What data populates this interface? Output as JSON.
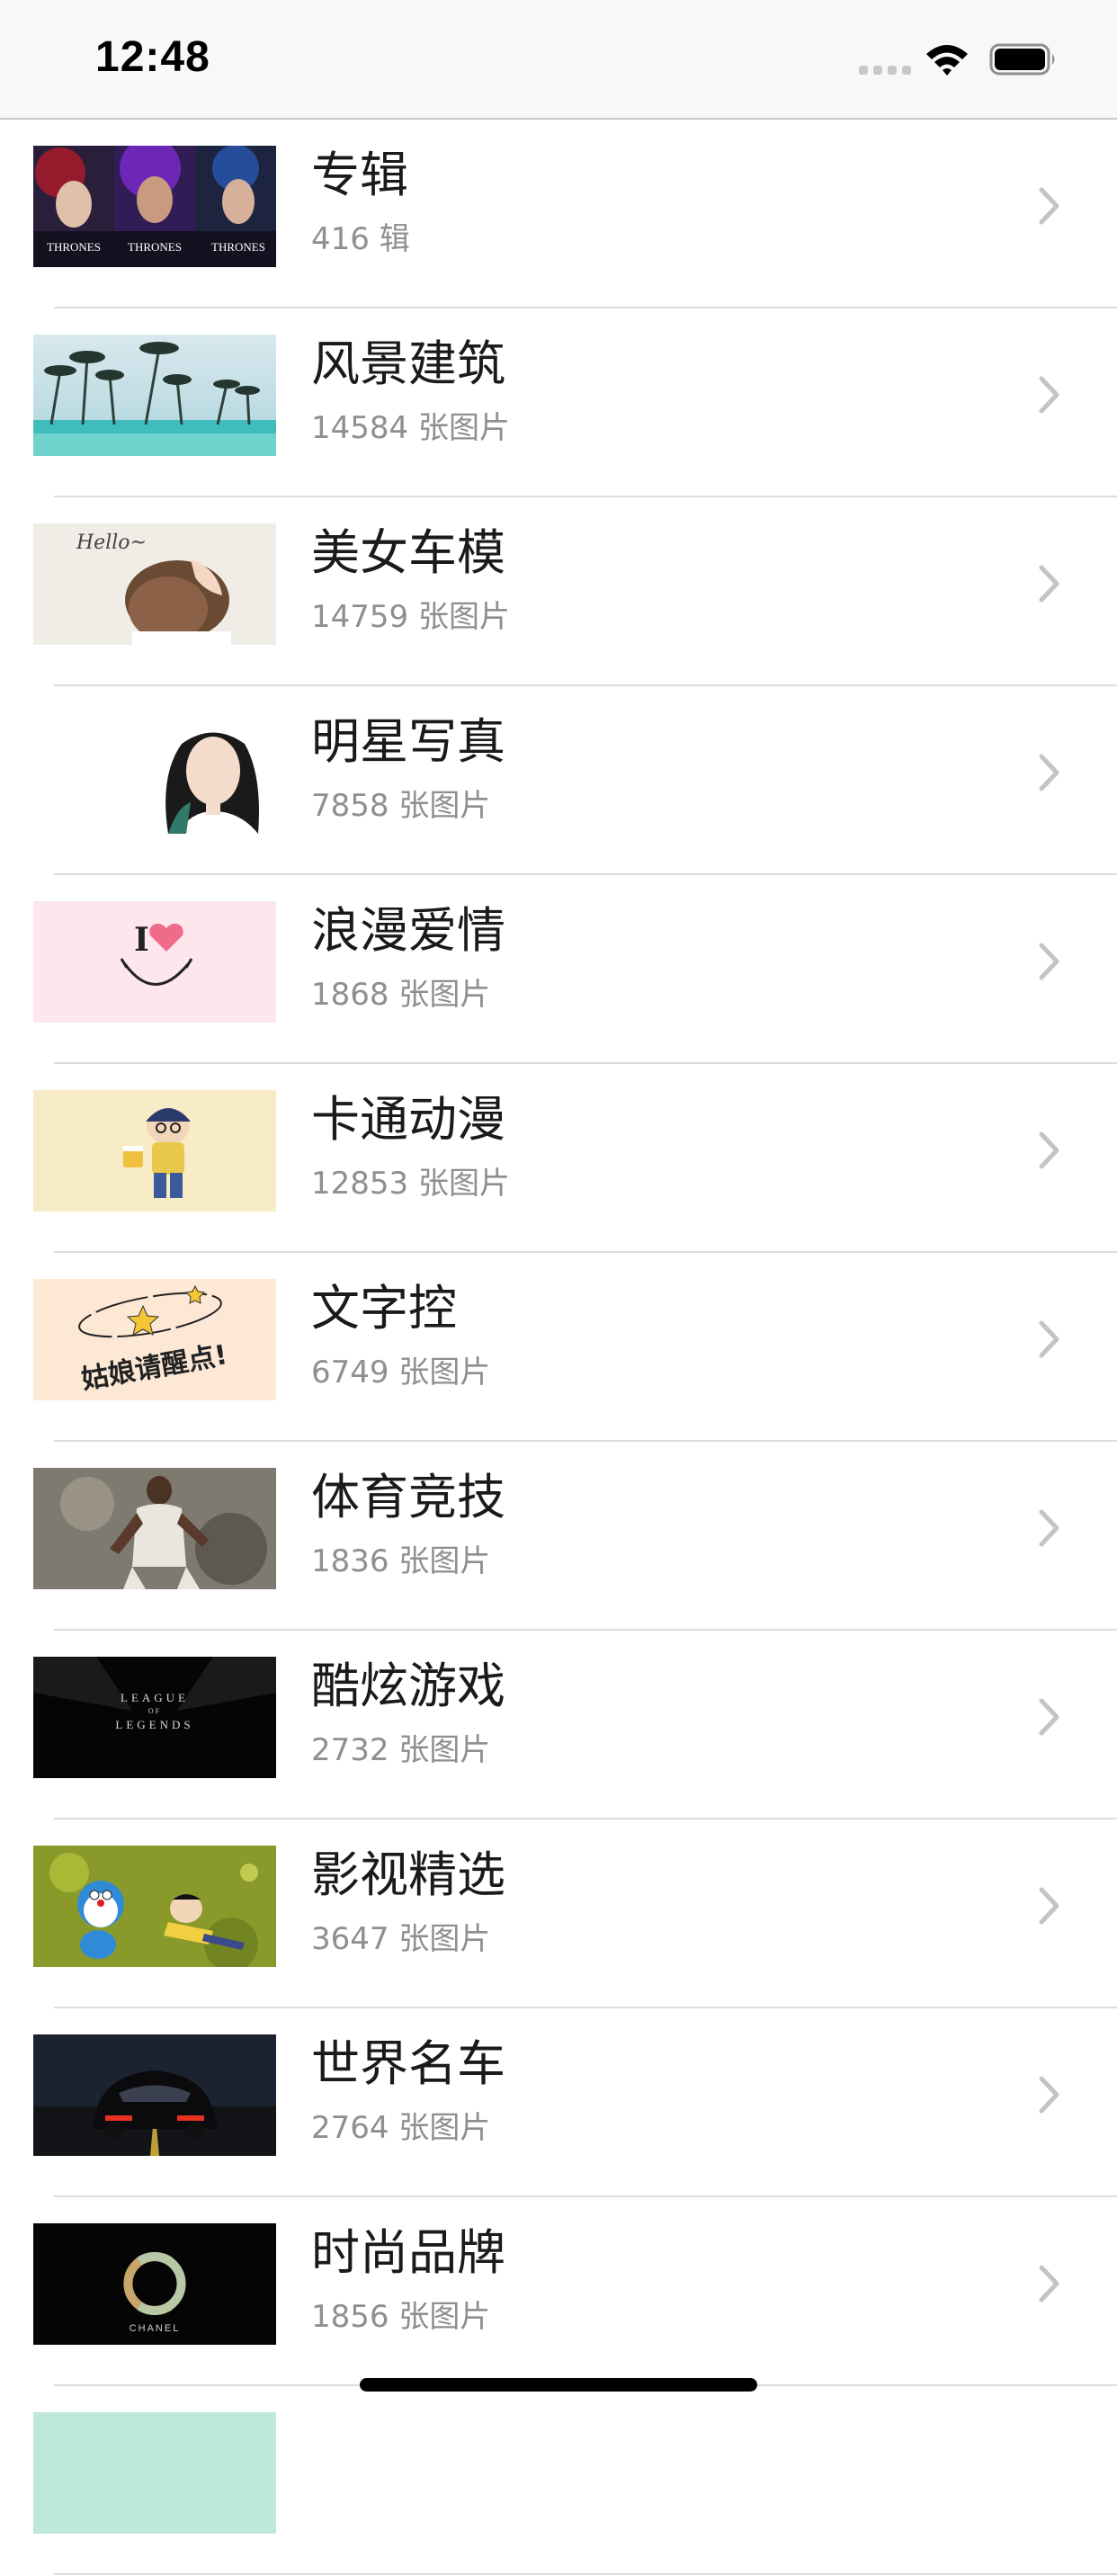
{
  "status_bar": {
    "time": "12:48"
  },
  "items": [
    {
      "title": "专辑",
      "subtitle": "416 辑",
      "icon": "game-of-thrones-thumbnail"
    },
    {
      "title": "风景建筑",
      "subtitle": "14584 张图片",
      "icon": "palm-beach-thumbnail"
    },
    {
      "title": "美女车模",
      "subtitle": "14759 张图片",
      "icon": "hello-girl-thumbnail"
    },
    {
      "title": "明星写真",
      "subtitle": "7858 张图片",
      "icon": "celebrity-portrait-thumbnail"
    },
    {
      "title": "浪漫爱情",
      "subtitle": "1868 张图片",
      "icon": "i-love-smile-thumbnail"
    },
    {
      "title": "卡通动漫",
      "subtitle": "12853 张图片",
      "icon": "cartoon-boy-thumbnail"
    },
    {
      "title": "文字控",
      "subtitle": "6749 张图片",
      "icon": "handwriting-text-thumbnail"
    },
    {
      "title": "体育竞技",
      "subtitle": "1836 张图片",
      "icon": "basketball-player-thumbnail"
    },
    {
      "title": "酷炫游戏",
      "subtitle": "2732 张图片",
      "icon": "league-of-legends-thumbnail"
    },
    {
      "title": "影视精选",
      "subtitle": "3647 张图片",
      "icon": "doraemon-thumbnail"
    },
    {
      "title": "世界名车",
      "subtitle": "2764 张图片",
      "icon": "supercar-thumbnail"
    },
    {
      "title": "时尚品牌",
      "subtitle": "1856 张图片",
      "icon": "chanel-logo-thumbnail"
    }
  ],
  "thumbnail_text": {
    "got": "THRONES",
    "hello": "Hello~",
    "love_i": "I",
    "handwriting": "姑娘请醒点!",
    "lol_line1": "LEAGUE",
    "lol_line2": "OF",
    "lol_line3": "LEGENDS",
    "chanel": "CHANEL"
  }
}
